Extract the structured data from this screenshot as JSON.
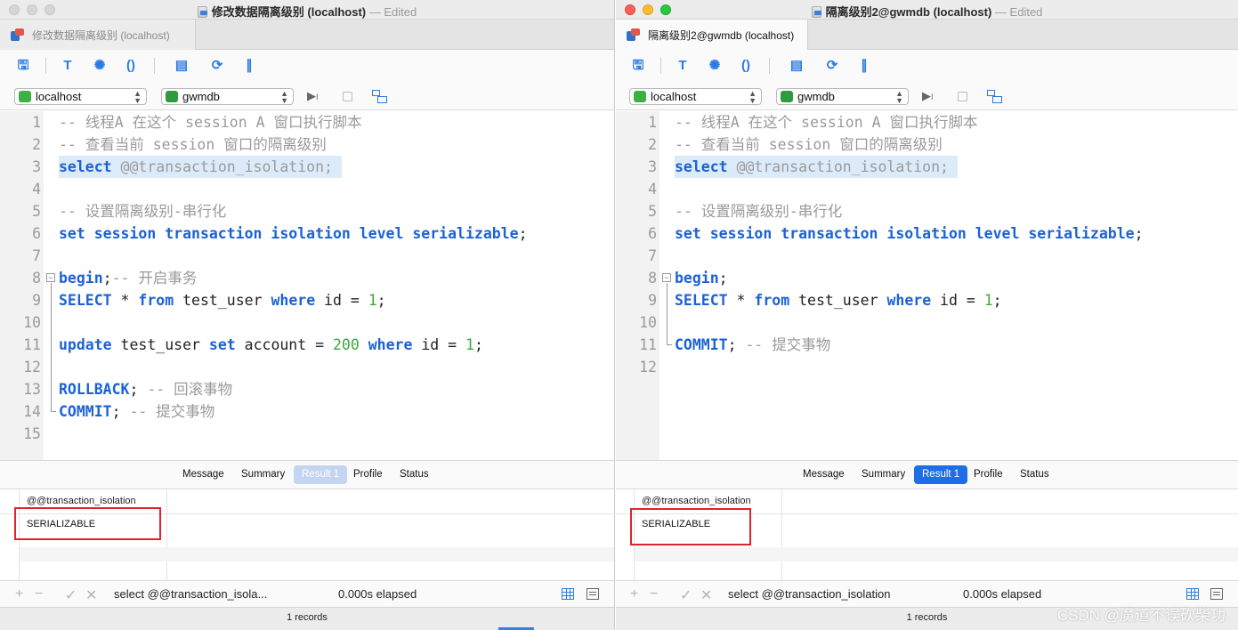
{
  "colors": {
    "keyword": "#1b62d8",
    "comment": "#9a9a9a",
    "number": "#3da83d",
    "line_highlight": "#dcebfa",
    "active_tab": "#1e6ee8",
    "red_box": "#e0242b"
  },
  "left": {
    "title": "修改数据隔离级别 (localhost)",
    "edited": "— Edited",
    "tab_label": "修改数据隔离级别 (localhost)",
    "connection": "localhost",
    "database": "gwmdb",
    "code": [
      [
        {
          "t": "-- 线程A 在这个 session A 窗口执行脚本",
          "c": "cm"
        }
      ],
      [
        {
          "t": "-- 查看当前 session 窗口的隔离级别",
          "c": "cm"
        }
      ],
      [
        {
          "t": "select",
          "c": "kw"
        },
        {
          "t": " @@transaction_isolation;",
          "c": "cm"
        }
      ],
      [],
      [
        {
          "t": "-- 设置隔离级别-串行化",
          "c": "cm"
        }
      ],
      [
        {
          "t": "set session transaction isolation level serializable",
          "c": "kw"
        },
        {
          "t": ";",
          "c": "id"
        }
      ],
      [],
      [
        {
          "t": "begin",
          "c": "kw"
        },
        {
          "t": ";",
          "c": "id"
        },
        {
          "t": "-- 开启事务",
          "c": "cm"
        }
      ],
      [
        {
          "t": "SELECT",
          "c": "kw"
        },
        {
          "t": " * ",
          "c": "id"
        },
        {
          "t": "from",
          "c": "kw"
        },
        {
          "t": " test_user ",
          "c": "id"
        },
        {
          "t": "where",
          "c": "kw"
        },
        {
          "t": " id = ",
          "c": "id"
        },
        {
          "t": "1",
          "c": "num"
        },
        {
          "t": ";",
          "c": "id"
        }
      ],
      [],
      [
        {
          "t": "update",
          "c": "kw"
        },
        {
          "t": " test_user ",
          "c": "id"
        },
        {
          "t": "set",
          "c": "kw"
        },
        {
          "t": " account = ",
          "c": "id"
        },
        {
          "t": "200",
          "c": "num"
        },
        {
          "t": " ",
          "c": "id"
        },
        {
          "t": "where",
          "c": "kw"
        },
        {
          "t": " id = ",
          "c": "id"
        },
        {
          "t": "1",
          "c": "num"
        },
        {
          "t": ";",
          "c": "id"
        }
      ],
      [],
      [
        {
          "t": "ROLLBACK",
          "c": "kw"
        },
        {
          "t": "; ",
          "c": "id"
        },
        {
          "t": "-- 回滚事物",
          "c": "cm"
        }
      ],
      [
        {
          "t": "COMMIT",
          "c": "kw"
        },
        {
          "t": "; ",
          "c": "id"
        },
        {
          "t": "-- 提交事物",
          "c": "cm"
        }
      ],
      []
    ],
    "highlight_line": 3,
    "result_tabs": [
      "Message",
      "Summary",
      "Result 1",
      "Profile",
      "Status"
    ],
    "active_result_tab": 2,
    "column_header": "@@transaction_isolation",
    "cell_value": "SERIALIZABLE",
    "status_query": "select @@transaction_isola...",
    "elapsed": "0.000s elapsed",
    "records": "1 records"
  },
  "right": {
    "title": "隔离级别2@gwmdb (localhost)",
    "edited": "— Edited",
    "tab_label": "隔离级别2@gwmdb (localhost)",
    "connection": "localhost",
    "database": "gwmdb",
    "code": [
      [
        {
          "t": "-- 线程A 在这个 session A 窗口执行脚本",
          "c": "cm"
        }
      ],
      [
        {
          "t": "-- 查看当前 session 窗口的隔离级别",
          "c": "cm"
        }
      ],
      [
        {
          "t": "select",
          "c": "kw"
        },
        {
          "t": " @@transaction_isolation;",
          "c": "cm"
        }
      ],
      [],
      [
        {
          "t": "-- 设置隔离级别-串行化",
          "c": "cm"
        }
      ],
      [
        {
          "t": "set session transaction isolation level serializable",
          "c": "kw"
        },
        {
          "t": ";",
          "c": "id"
        }
      ],
      [],
      [
        {
          "t": "begin",
          "c": "kw"
        },
        {
          "t": ";",
          "c": "id"
        }
      ],
      [
        {
          "t": "SELECT",
          "c": "kw"
        },
        {
          "t": " * ",
          "c": "id"
        },
        {
          "t": "from",
          "c": "kw"
        },
        {
          "t": " test_user ",
          "c": "id"
        },
        {
          "t": "where",
          "c": "kw"
        },
        {
          "t": " id = ",
          "c": "id"
        },
        {
          "t": "1",
          "c": "num"
        },
        {
          "t": ";",
          "c": "id"
        }
      ],
      [],
      [
        {
          "t": "COMMIT",
          "c": "kw"
        },
        {
          "t": "; ",
          "c": "id"
        },
        {
          "t": "-- 提交事物",
          "c": "cm"
        }
      ],
      []
    ],
    "highlight_line": 3,
    "result_tabs": [
      "Message",
      "Summary",
      "Result 1",
      "Profile",
      "Status"
    ],
    "active_result_tab": 2,
    "column_header": "@@transaction_isolation",
    "cell_value": "SERIALIZABLE",
    "status_query": "select @@transaction_isolation",
    "elapsed": "0.000s elapsed",
    "records": "1 records"
  },
  "toolbar_icons": [
    "save-icon",
    "format-icon",
    "beautify-icon",
    "parentheses-icon",
    "text-file-icon",
    "export-icon",
    "chart-icon"
  ],
  "status_buttons": [
    "add-icon",
    "remove-icon",
    "apply-icon",
    "discard-icon"
  ],
  "watermark": "CSDN @魔道不误砍柴功"
}
